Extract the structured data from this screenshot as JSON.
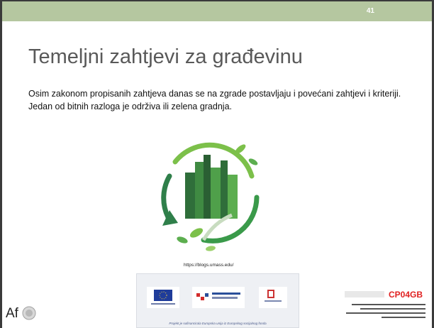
{
  "slide": {
    "number": "41",
    "title": "Temeljni zahtjevi za građevinu",
    "paragraphs": [
      "Osim zakonom propisanih zahtjeva danas se na zgrade postavljaju i povećani zahtjevi i kriteriji.",
      "Jedan od bitnih razloga je održiva ili zelena gradnja."
    ],
    "image_source": "https://blogs.umass.edu/",
    "accent_color": "#b5c7a0"
  },
  "footer": {
    "left_logo_text": "Af",
    "banner_caption": "Projekt je sufinancirala Europska unija iz Europskog socijalnog fonda",
    "banner_logos": [
      "eu-flag-icon",
      "structural-funds-icon",
      "ministry-icon"
    ],
    "right_logo_text": "CP04GB"
  }
}
